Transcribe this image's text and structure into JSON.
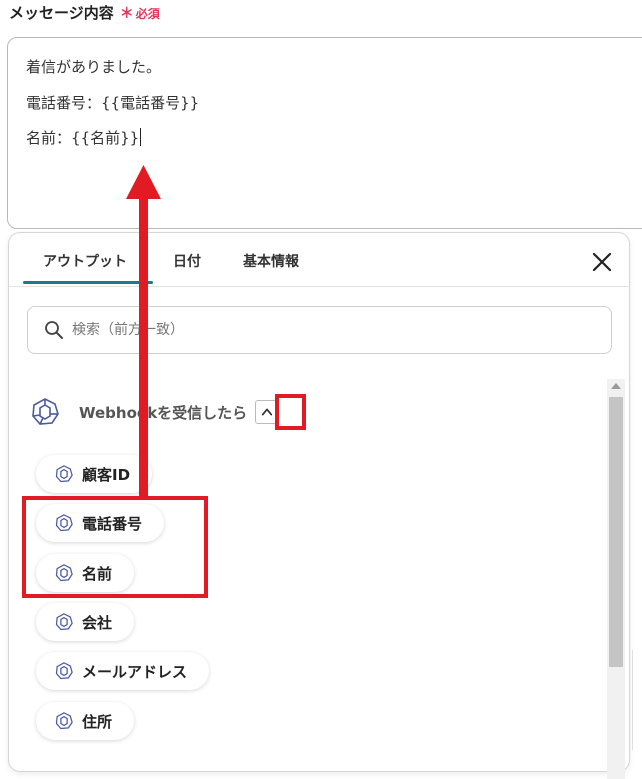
{
  "field": {
    "label": "メッセージ内容",
    "required_mark": "＊",
    "required_text": "必須"
  },
  "message": {
    "lines": [
      "着信がありました。",
      "電話番号：{{電話番号}}",
      "名前：{{名前}}"
    ]
  },
  "panel": {
    "tabs": [
      {
        "label": "アウトプット",
        "active": true
      },
      {
        "label": "日付",
        "active": false
      },
      {
        "label": "基本情報",
        "active": false
      }
    ],
    "close_icon": "close-icon",
    "search": {
      "placeholder": "検索（前方一致）",
      "value": "",
      "icon": "search-icon"
    },
    "group": {
      "title": "Webhookを受信したら",
      "icon": "webhook-icon",
      "expanded": true
    },
    "items": [
      {
        "label": "顧客ID",
        "icon": "webhook-icon"
      },
      {
        "label": "電話番号",
        "icon": "webhook-icon"
      },
      {
        "label": "名前",
        "icon": "webhook-icon"
      },
      {
        "label": "会社",
        "icon": "webhook-icon"
      },
      {
        "label": "メールアドレス",
        "icon": "webhook-icon"
      },
      {
        "label": "住所",
        "icon": "webhook-icon"
      }
    ]
  },
  "colors": {
    "required": "#e0365a",
    "tab_active_underline": "#1c7a8a",
    "webhook_icon": "#4a5aa0",
    "annotation": "#e01b24"
  }
}
